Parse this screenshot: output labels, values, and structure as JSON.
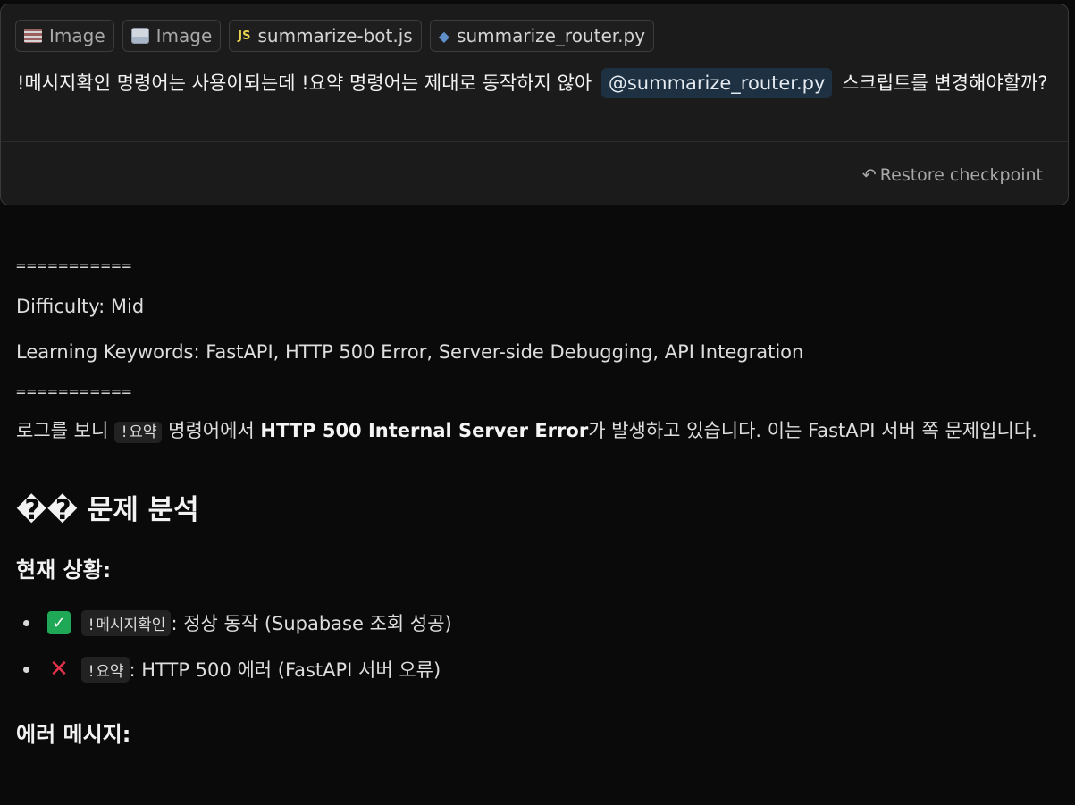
{
  "message": {
    "attachments": [
      {
        "label": "Image",
        "icon": "database-image-icon"
      },
      {
        "label": "Image",
        "icon": "image-icon"
      },
      {
        "label": "summarize-bot.js",
        "icon": "js-file-icon"
      },
      {
        "label": "summarize_router.py",
        "icon": "python-file-icon"
      }
    ],
    "text_before": "!메시지확인 명령어는 사용이되는데 !요약 명령어는 제대로 동작하지 않아",
    "mention": "@summarize_router.py",
    "text_after": "스크립트를 변경해야할까?",
    "restore_label": "Restore checkpoint"
  },
  "response": {
    "rule": "===========",
    "difficulty": "Difficulty: Mid",
    "keywords": "Learning Keywords: FastAPI, HTTP 500 Error, Server-side Debugging, API Integration",
    "intro_1": "로그를 보니 ",
    "intro_code": "!요약",
    "intro_2": " 명령어에서 ",
    "intro_bold": "HTTP 500 Internal Server Error",
    "intro_3": "가 발생하고 있습니다. 이는 FastAPI 서버 쪽 문제입니다.",
    "heading_analysis": "�� 문제 분석",
    "heading_status": "현재 상황:",
    "status_items": [
      {
        "icon": "check-mark-icon",
        "code": "!메시지확인",
        "text": ": 정상 동작 (Supabase 조회 성공)"
      },
      {
        "icon": "cross-mark-icon",
        "code": "!요약",
        "text": ": HTTP 500 에러 (FastAPI 서버 오류)"
      }
    ],
    "heading_error": "에러 메시지:"
  },
  "colors": {
    "background": "#0a0a0a",
    "card": "#1b1b1b",
    "mention_bg": "#1d3142",
    "ok_green": "#1fa855",
    "error_red": "#e5334b"
  }
}
